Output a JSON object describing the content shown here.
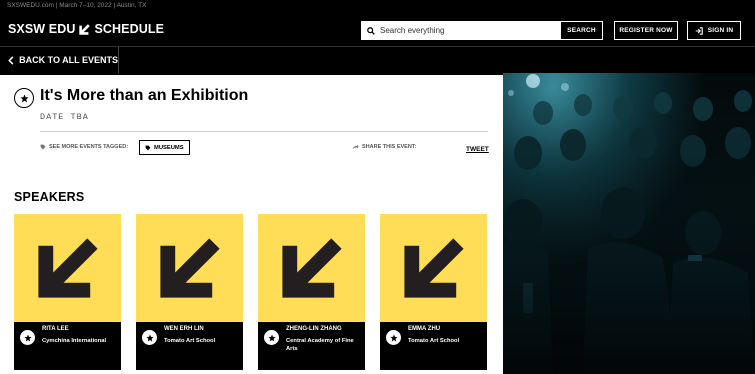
{
  "top_strip": "SXSWEDU.com | March 7–10, 2022 | Austin, TX",
  "header": {
    "brand": "SXSW EDU",
    "schedule": "SCHEDULE",
    "search_placeholder": "Search everything",
    "search_button": "SEARCH",
    "register_button": "REGISTER NOW",
    "signin_button": "SIGN IN"
  },
  "subbar": {
    "back_label": "BACK TO ALL EVENTS"
  },
  "event": {
    "title": "It's More than an Exhibition",
    "date": "DATE TBA",
    "tagged_label": "SEE MORE EVENTS TAGGED:",
    "tag": "MUSEUMS",
    "share_label": "SHARE THIS EVENT:",
    "tweet": "TWEET"
  },
  "speakers": {
    "heading": "SPEAKERS",
    "items": [
      {
        "name": "RITA LEE",
        "org": "Cymchina International"
      },
      {
        "name": "WEN ERH LIN",
        "org": "Tomato Art School"
      },
      {
        "name": "ZHENG-LIN ZHANG",
        "org": "Central Academy of Fine Arts"
      },
      {
        "name": "EMMA ZHU",
        "org": "Tomato Art School"
      }
    ]
  },
  "colors": {
    "accent_yellow": "#ffdd57",
    "black": "#000000",
    "white": "#ffffff"
  },
  "icons": [
    "search-icon",
    "signin-icon",
    "chevron-left-icon",
    "star-icon",
    "tag-icon",
    "share-icon",
    "sxsw-arrow-icon"
  ]
}
